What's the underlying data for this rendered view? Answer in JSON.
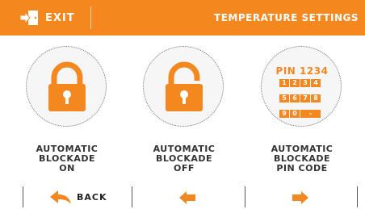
{
  "colors": {
    "accent": "#f5871f",
    "text": "#333333"
  },
  "header": {
    "exit_label": "EXIT",
    "exit_icon": "exit-door-icon",
    "title": "TEMPERATURE SETTINGS"
  },
  "options": [
    {
      "icon": "padlock-closed-icon",
      "lines": [
        "AUTOMATIC",
        "BLOCKADE",
        "ON"
      ]
    },
    {
      "icon": "padlock-open-icon",
      "lines": [
        "AUTOMATIC",
        "BLOCKADE",
        "OFF"
      ]
    },
    {
      "icon": "pin-keypad-icon",
      "pin_title": "PIN 1234",
      "keys": [
        "1",
        "2",
        "3",
        "4",
        "5",
        "6",
        "7",
        "8",
        "9",
        "0",
        "-"
      ],
      "lines": [
        "AUTOMATIC",
        "BLOCKADE",
        "PIN CODE"
      ]
    }
  ],
  "footer": {
    "back_label": "BACK",
    "back_icon": "back-arrow-icon",
    "left_icon": "arrow-left-icon",
    "right_icon": "arrow-right-icon"
  }
}
